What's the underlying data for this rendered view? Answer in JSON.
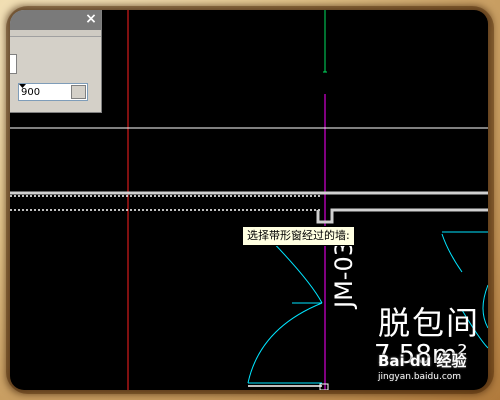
{
  "toolbox": {
    "close_label": "×",
    "width_value": "900"
  },
  "tooltip": {
    "prompt": "选择带形窗经过的墙:"
  },
  "drawing": {
    "window_code": "JM-03",
    "room_name": "脱包间",
    "room_area": "7.58m²"
  },
  "watermark": {
    "brand": "Bai du 经验",
    "url": "jingyan.baidu.com"
  },
  "colors": {
    "canvas_bg": "#000000",
    "axis_red": "#ff2020",
    "axis_green": "#00e060",
    "axis_magenta": "#ff00ff",
    "wall_white": "#ffffff",
    "arc_cyan": "#00e5ff"
  }
}
